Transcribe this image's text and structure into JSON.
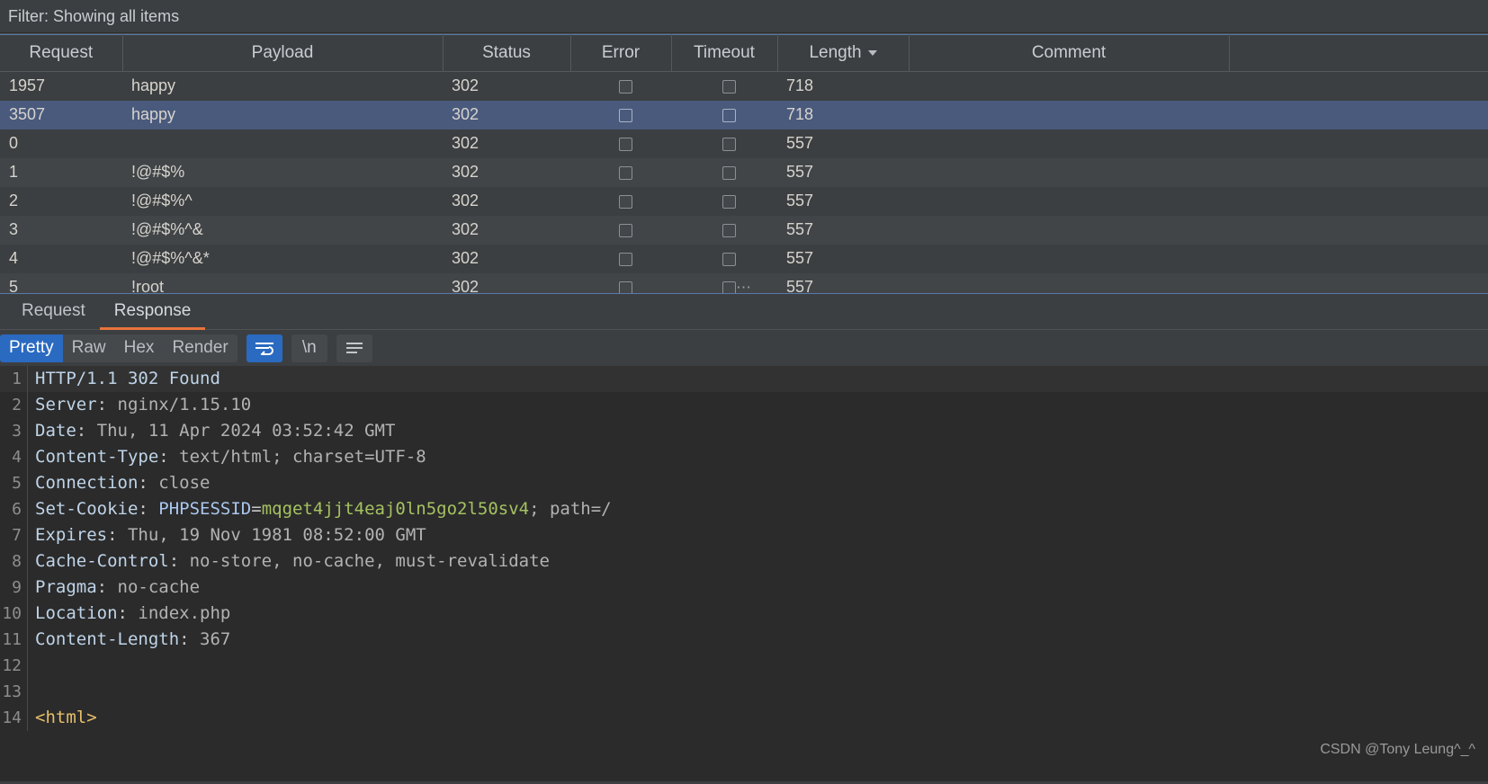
{
  "filter": {
    "label": "Filter: Showing all items"
  },
  "results_table": {
    "columns": [
      {
        "key": "request",
        "label": "Request"
      },
      {
        "key": "payload",
        "label": "Payload"
      },
      {
        "key": "status",
        "label": "Status"
      },
      {
        "key": "error",
        "label": "Error"
      },
      {
        "key": "timeout",
        "label": "Timeout"
      },
      {
        "key": "length",
        "label": "Length",
        "sort_icon": "chevron-down-icon"
      },
      {
        "key": "comment",
        "label": "Comment"
      },
      {
        "key": "spacer",
        "label": ""
      }
    ],
    "rows": [
      {
        "request": "1957",
        "payload": "happy",
        "status": "302",
        "error": false,
        "timeout": false,
        "length": "718",
        "comment": "",
        "selected": false
      },
      {
        "request": "3507",
        "payload": "happy",
        "status": "302",
        "error": false,
        "timeout": false,
        "length": "718",
        "comment": "",
        "selected": true
      },
      {
        "request": "0",
        "payload": "",
        "status": "302",
        "error": false,
        "timeout": false,
        "length": "557",
        "comment": "",
        "selected": false
      },
      {
        "request": "1",
        "payload": "!@#$%",
        "status": "302",
        "error": false,
        "timeout": false,
        "length": "557",
        "comment": "",
        "selected": false
      },
      {
        "request": "2",
        "payload": "!@#$%^",
        "status": "302",
        "error": false,
        "timeout": false,
        "length": "557",
        "comment": "",
        "selected": false
      },
      {
        "request": "3",
        "payload": "!@#$%^&",
        "status": "302",
        "error": false,
        "timeout": false,
        "length": "557",
        "comment": "",
        "selected": false
      },
      {
        "request": "4",
        "payload": "!@#$%^&*",
        "status": "302",
        "error": false,
        "timeout": false,
        "length": "557",
        "comment": "",
        "selected": false
      },
      {
        "request": "5",
        "payload": "!root",
        "status": "302",
        "error": false,
        "timeout": false,
        "length": "557",
        "comment": "",
        "selected": false
      }
    ]
  },
  "message_tabs": [
    {
      "label": "Request",
      "active": false
    },
    {
      "label": "Response",
      "active": true
    }
  ],
  "view_toolbar": {
    "view_modes": [
      {
        "label": "Pretty",
        "active": true
      },
      {
        "label": "Raw",
        "active": false
      },
      {
        "label": "Hex",
        "active": false
      },
      {
        "label": "Render",
        "active": false
      }
    ],
    "word_wrap_button": {
      "icon": "word-wrap-icon",
      "active": true
    },
    "newline_button": {
      "label": "\\n",
      "icon": "newline-icon",
      "active": false
    },
    "actions_button": {
      "icon": "hamburger-menu-icon",
      "active": false
    }
  },
  "response": {
    "lines": [
      {
        "num": "1",
        "highlight": true,
        "segments": [
          {
            "text": "HTTP/1.1 302 Found",
            "cls": "tok-hdr"
          }
        ]
      },
      {
        "num": "2",
        "highlight": false,
        "segments": [
          {
            "text": "Server",
            "cls": "tok-hdr"
          },
          {
            "text": ": ",
            "cls": "tok-plain"
          },
          {
            "text": "nginx/1.15.10",
            "cls": "tok-val"
          }
        ]
      },
      {
        "num": "3",
        "highlight": false,
        "segments": [
          {
            "text": "Date",
            "cls": "tok-hdr"
          },
          {
            "text": ": ",
            "cls": "tok-plain"
          },
          {
            "text": "Thu, 11 Apr 2024 03:52:42 GMT",
            "cls": "tok-val"
          }
        ]
      },
      {
        "num": "4",
        "highlight": false,
        "segments": [
          {
            "text": "Content-Type",
            "cls": "tok-hdr"
          },
          {
            "text": ": ",
            "cls": "tok-plain"
          },
          {
            "text": "text/html; charset=UTF-8",
            "cls": "tok-val"
          }
        ]
      },
      {
        "num": "5",
        "highlight": false,
        "segments": [
          {
            "text": "Connection",
            "cls": "tok-hdr"
          },
          {
            "text": ": ",
            "cls": "tok-plain"
          },
          {
            "text": "close",
            "cls": "tok-val"
          }
        ]
      },
      {
        "num": "6",
        "highlight": false,
        "segments": [
          {
            "text": "Set-Cookie",
            "cls": "tok-hdr"
          },
          {
            "text": ": ",
            "cls": "tok-plain"
          },
          {
            "text": "PHPSESSID",
            "cls": "tok-key"
          },
          {
            "text": "=",
            "cls": "tok-plain"
          },
          {
            "text": "mqget4jjt4eaj0ln5go2l50sv4",
            "cls": "tok-green"
          },
          {
            "text": "; path=/",
            "cls": "tok-val"
          }
        ]
      },
      {
        "num": "7",
        "highlight": false,
        "segments": [
          {
            "text": "Expires",
            "cls": "tok-hdr"
          },
          {
            "text": ": ",
            "cls": "tok-plain"
          },
          {
            "text": "Thu, 19 Nov 1981 08:52:00 GMT",
            "cls": "tok-val"
          }
        ]
      },
      {
        "num": "8",
        "highlight": false,
        "segments": [
          {
            "text": "Cache-Control",
            "cls": "tok-hdr"
          },
          {
            "text": ": ",
            "cls": "tok-plain"
          },
          {
            "text": "no-store, no-cache, must-revalidate",
            "cls": "tok-val"
          }
        ]
      },
      {
        "num": "9",
        "highlight": false,
        "segments": [
          {
            "text": "Pragma",
            "cls": "tok-hdr"
          },
          {
            "text": ": ",
            "cls": "tok-plain"
          },
          {
            "text": "no-cache",
            "cls": "tok-val"
          }
        ]
      },
      {
        "num": "10",
        "highlight": false,
        "segments": [
          {
            "text": "Location",
            "cls": "tok-hdr"
          },
          {
            "text": ": ",
            "cls": "tok-plain"
          },
          {
            "text": "index.php",
            "cls": "tok-val"
          }
        ]
      },
      {
        "num": "11",
        "highlight": false,
        "segments": [
          {
            "text": "Content-Length",
            "cls": "tok-hdr"
          },
          {
            "text": ": ",
            "cls": "tok-plain"
          },
          {
            "text": "367",
            "cls": "tok-val"
          }
        ]
      },
      {
        "num": "12",
        "highlight": false,
        "segments": []
      },
      {
        "num": "13",
        "highlight": false,
        "segments": []
      },
      {
        "num": "14",
        "highlight": false,
        "segments": [
          {
            "text": "<html>",
            "cls": "tok-tag"
          }
        ]
      }
    ]
  },
  "watermark": {
    "text": "CSDN @Tony Leung^_^"
  }
}
